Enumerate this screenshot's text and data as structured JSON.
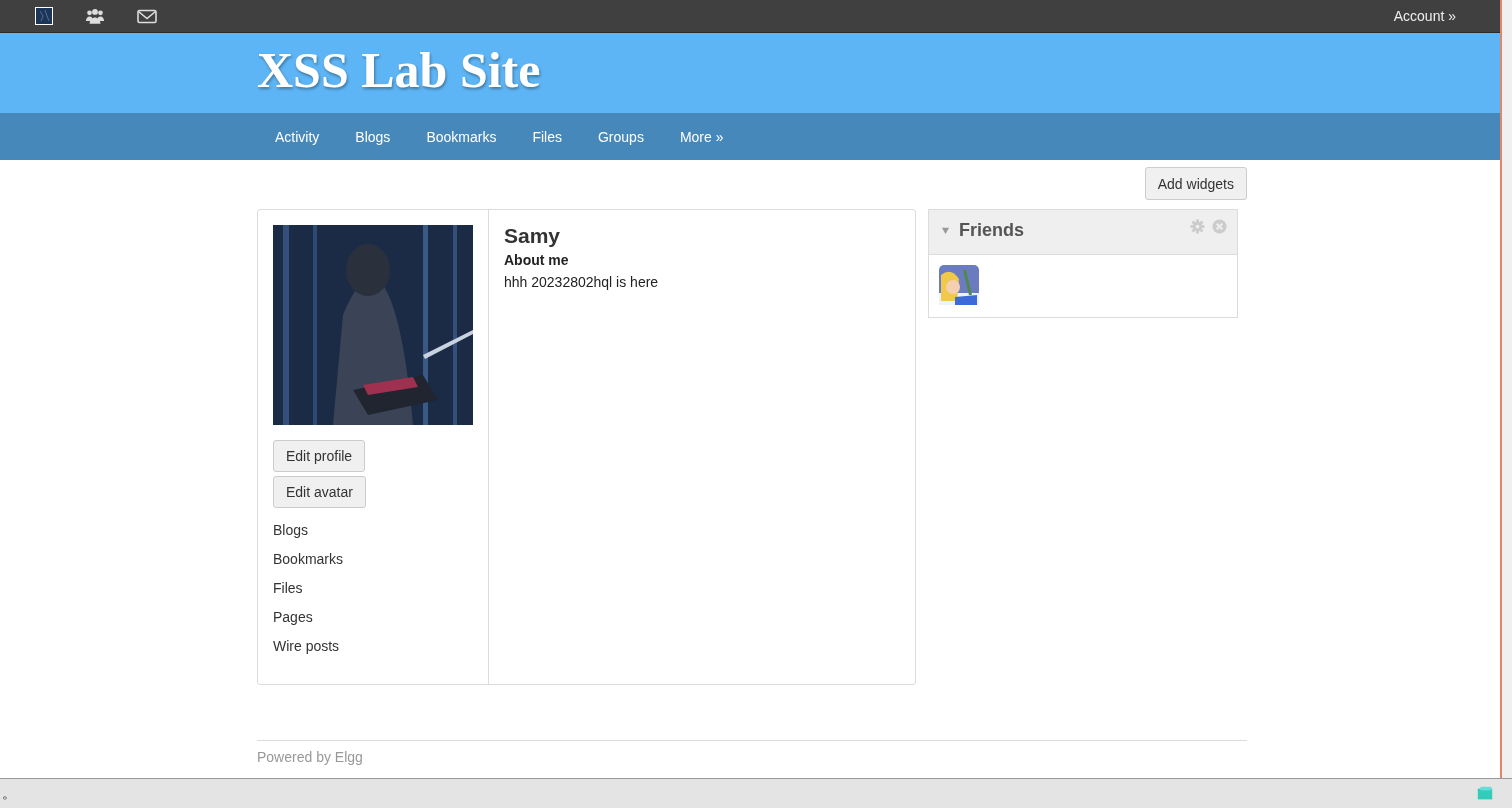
{
  "topbar": {
    "account": "Account",
    "account_arrow": "»"
  },
  "site": {
    "title": "XSS Lab Site"
  },
  "nav": [
    {
      "label": "Activity"
    },
    {
      "label": "Blogs"
    },
    {
      "label": "Bookmarks"
    },
    {
      "label": "Files"
    },
    {
      "label": "Groups"
    },
    {
      "label": "More",
      "arrow": "»"
    }
  ],
  "add_widgets": "Add widgets",
  "profile": {
    "buttons": [
      "Edit profile",
      "Edit avatar"
    ],
    "links": [
      "Blogs",
      "Bookmarks",
      "Files",
      "Pages",
      "Wire posts"
    ],
    "name": "Samy",
    "about_heading": "About me",
    "about_text": "hhh 20232802hql is here"
  },
  "friends_widget": {
    "title": "Friends",
    "expanded": true
  },
  "footer": {
    "text": "Powered by Elgg"
  },
  "status_bar": {
    "text": "。"
  }
}
